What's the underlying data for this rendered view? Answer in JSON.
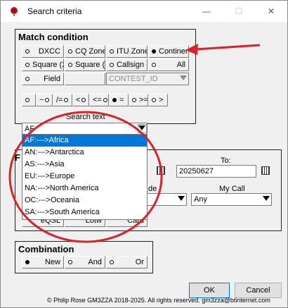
{
  "window": {
    "title": "Search criteria",
    "minimize_glyph": "—",
    "maximize_glyph": "☐",
    "close_glyph": "✕"
  },
  "match_condition": {
    "title": "Match condition",
    "options": [
      {
        "label": "DXCC",
        "selected": false
      },
      {
        "label": "CQ Zone",
        "selected": false
      },
      {
        "label": "ITU Zone",
        "selected": false
      },
      {
        "label": "Continent",
        "selected": true
      },
      {
        "label": "Square (2)",
        "selected": false
      },
      {
        "label": "Square (4)",
        "selected": false
      },
      {
        "label": "Callsign",
        "selected": false
      },
      {
        "label": "All",
        "selected": false
      },
      {
        "label": "Field",
        "selected": false
      }
    ],
    "field_combo_value": "CONTEST_ID",
    "operators": [
      {
        "label": "~",
        "selected": false
      },
      {
        "label": "/=",
        "selected": false
      },
      {
        "label": "<",
        "selected": false
      },
      {
        "label": "<=",
        "selected": false
      },
      {
        "label": "=",
        "selected": true
      },
      {
        "label": ">=",
        "selected": false
      },
      {
        "label": ">",
        "selected": false
      }
    ],
    "search_text_label": "Search text",
    "search_text_value": "AF"
  },
  "continent_list": [
    "AF:--->Africa",
    "AN:--->Antarctica",
    "AS:--->Asia",
    "EU:--->Europe",
    "NA:--->North America",
    "OC:--->Oceania",
    "SA:--->South America"
  ],
  "date_group": {
    "title_initial": "F",
    "to_label": "To:",
    "to_value": "20250627",
    "mode_label_fragment": "de",
    "mycall_label": "My Call",
    "mycall_value": "Any",
    "qsl_labels": [
      "eQSL",
      "Lotw",
      "Card"
    ]
  },
  "combination": {
    "title": "Combination",
    "options": [
      {
        "label": "New",
        "selected": true
      },
      {
        "label": "And",
        "selected": false
      },
      {
        "label": "Or",
        "selected": false
      }
    ]
  },
  "buttons": {
    "ok": "OK",
    "cancel": "Cancel"
  },
  "footer": "© Philip Rose GM3ZZA 2018-2025. All rights reserved. gm3zza@btinternet.com",
  "colors": {
    "annotation": "#d8232a",
    "selection": "#0078d7"
  }
}
